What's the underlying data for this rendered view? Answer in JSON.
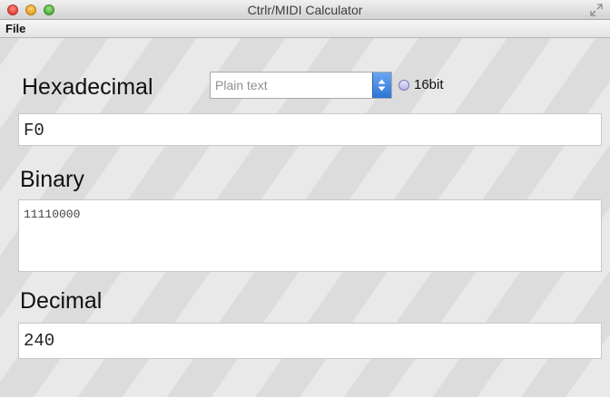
{
  "window": {
    "title": "Ctrlr/MIDI Calculator"
  },
  "menu": {
    "file": "File"
  },
  "hexadecimal": {
    "label": "Hexadecimal",
    "format_select": "Plain text",
    "bit_option": "16bit",
    "value": "F0"
  },
  "binary": {
    "label": "Binary",
    "value": "11110000"
  },
  "decimal": {
    "label": "Decimal",
    "value": "240"
  }
}
